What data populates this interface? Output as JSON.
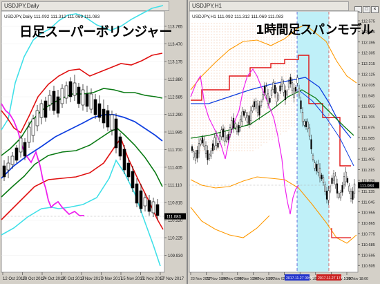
{
  "left": {
    "window_title": "USDJPY,Daily",
    "ohlc_text": "USDJPY,Daily  111.092 111.312 111.069 111.083",
    "overlay_title": "日足スーパーボリンジャー",
    "y_ticks": [
      "113.765",
      "113.470",
      "113.175",
      "112.880",
      "112.585",
      "112.290",
      "111.995",
      "111.700",
      "111.405",
      "111.110",
      "110.815",
      "110.520",
      "110.225",
      "109.930"
    ],
    "price_label": "111.083",
    "x_ticks": [
      "12 Oct 2017",
      "18 Oct 2017",
      "24 Oct 2017",
      "30 Oct 2017",
      "3 Nov 2017",
      "9 Nov 2017",
      "15 Nov 2017",
      "21 Nov 2017",
      "27 Nov 2017"
    ],
    "colors": {
      "bg": "#ffffff",
      "cyan": "#40e0e8",
      "red": "#e01010",
      "green": "#0a7a14",
      "blue": "#1040e0",
      "magenta": "#ee22ee",
      "candle": "#000000"
    }
  },
  "right": {
    "window_title": "USDJPY,H1",
    "ohlc_text": "USDJPY,H1  111.092 111.312 111.069 111.083",
    "overlay_title": "1時間足スパンモデル",
    "y_ticks": [
      "112.575",
      "112.485",
      "112.395",
      "112.305",
      "112.215",
      "112.125",
      "112.035",
      "111.945",
      "111.855",
      "111.765",
      "111.675",
      "111.585",
      "111.495",
      "111.405",
      "111.315",
      "111.225",
      "111.135",
      "111.045",
      "110.955",
      "110.865",
      "110.775",
      "110.685",
      "110.595",
      "110.505"
    ],
    "price_label": "111.083",
    "x_ticks": [
      "23 Nov 2017",
      "23 Nov 18:00",
      "24 Nov 02:00",
      "24 Nov 10:00",
      "24 Nov 18:00",
      "27 Nov 02:00",
      "27 Nov 10:00",
      "27 Nov 18:00",
      "28 Nov 02:00",
      "28 Nov 10:00",
      "28 Nov 18:00"
    ],
    "time_markers": [
      "2017.11.27 09:00",
      "2017.11.27 17:00"
    ],
    "colors": {
      "bg": "#ffffff",
      "orange": "#ff9900",
      "red": "#e01010",
      "green": "#0a7a14",
      "blue": "#1040e0",
      "magenta": "#ee22ee",
      "cyanZone": "#bff0f8",
      "dots": "#e8a070"
    }
  }
}
